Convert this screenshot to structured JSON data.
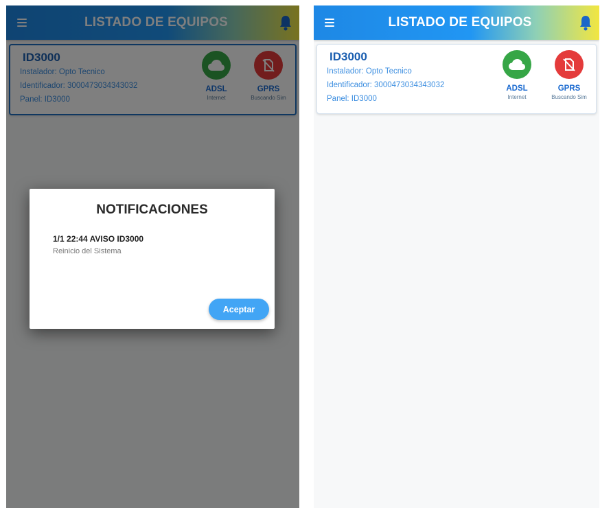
{
  "appbar": {
    "title": "LISTADO DE EQUIPOS"
  },
  "device": {
    "id": "ID3000",
    "installer": "Instalador: Opto Tecnico",
    "identification": "Identificador: 3000473034343032",
    "panel": "Panel: ID3000",
    "adsl": {
      "label": "ADSL",
      "sub": "Internet",
      "color": "#36a646",
      "icon": "cloud-icon"
    },
    "gprs": {
      "label": "GPRS",
      "sub": "Buscando Sim",
      "color": "#e43b3b",
      "icon": "no-sim-icon"
    }
  },
  "dialog": {
    "title": "NOTIFICACIONES",
    "notifications": [
      {
        "line": "1/1 22:44  AVISO ID3000",
        "description": "Reinicio del Sistema"
      }
    ],
    "accept_label": "Aceptar"
  },
  "colors": {
    "primary": "#2196f3",
    "accent_yellow": "#f2e640",
    "button": "#42a5f5",
    "overlay": "rgba(0,0,0,0.5)"
  }
}
